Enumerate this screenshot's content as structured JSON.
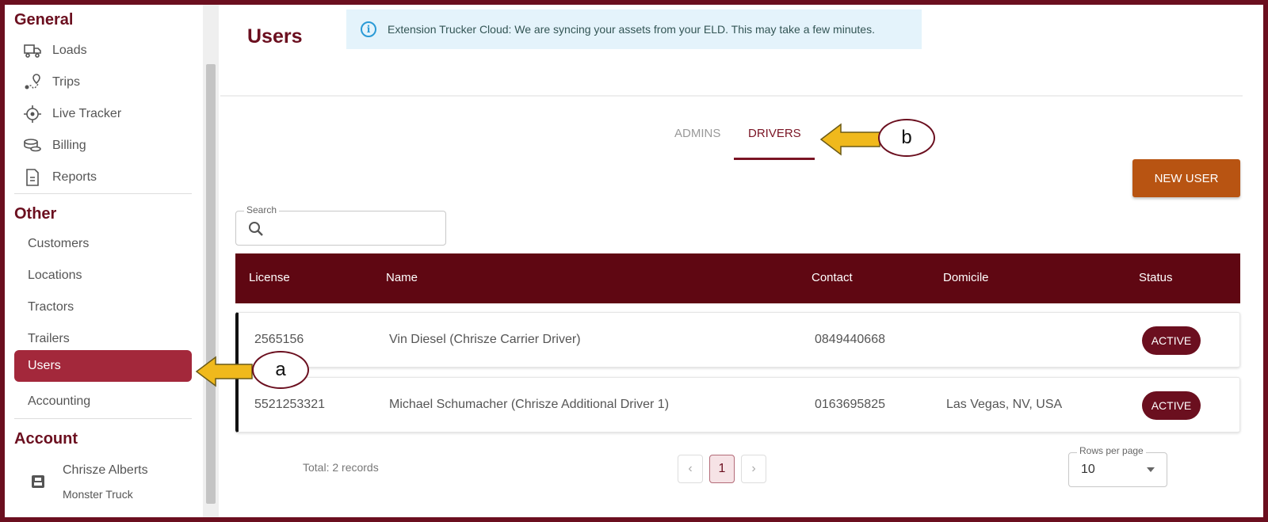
{
  "sidebar": {
    "general_title": "General",
    "general_items": [
      {
        "label": "Loads",
        "icon": "truck-icon"
      },
      {
        "label": "Trips",
        "icon": "route-pin-icon"
      },
      {
        "label": "Live Tracker",
        "icon": "crosshair-icon"
      },
      {
        "label": "Billing",
        "icon": "coins-icon"
      },
      {
        "label": "Reports",
        "icon": "document-icon"
      }
    ],
    "other_title": "Other",
    "other_items": [
      {
        "label": "Customers"
      },
      {
        "label": "Locations"
      },
      {
        "label": "Tractors"
      },
      {
        "label": "Trailers"
      },
      {
        "label": "Users",
        "active": true
      },
      {
        "label": "Accounting"
      }
    ],
    "account_title": "Account",
    "account": {
      "name": "Chrisze Alberts",
      "company": "Monster Truck",
      "icon": "id-card-icon"
    }
  },
  "header": {
    "title": "Users",
    "banner": "Extension Trucker Cloud: We are syncing your assets from your ELD. This may take a few minutes."
  },
  "tabs": [
    {
      "label": "ADMINS",
      "active": false
    },
    {
      "label": "DRIVERS",
      "active": true
    }
  ],
  "new_user_label": "NEW USER",
  "search": {
    "label": "Search",
    "placeholder": "",
    "value": ""
  },
  "table": {
    "columns": [
      "License",
      "Name",
      "Contact",
      "Domicile",
      "Status"
    ],
    "rows": [
      {
        "license": "2565156",
        "name": "Vin Diesel (Chrisze Carrier Driver)",
        "contact": "0849440668",
        "domicile": "",
        "status": "ACTIVE"
      },
      {
        "license": "5521253321",
        "name": "Michael Schumacher (Chrisze Additional Driver 1)",
        "contact": "0163695825",
        "domicile": "Las Vegas, NV, USA",
        "status": "ACTIVE"
      }
    ]
  },
  "footer": {
    "total": "Total: 2 records",
    "current_page": "1",
    "rows_per_page_label": "Rows per page",
    "rows_per_page_value": "10"
  },
  "annotations": {
    "a": "a",
    "b": "b"
  },
  "colors": {
    "brand": "#6b0f1f",
    "active_nav": "#a3283b",
    "new_user": "#b85412",
    "arrow": "#f0b91c",
    "banner_bg": "#e4f3fb"
  }
}
